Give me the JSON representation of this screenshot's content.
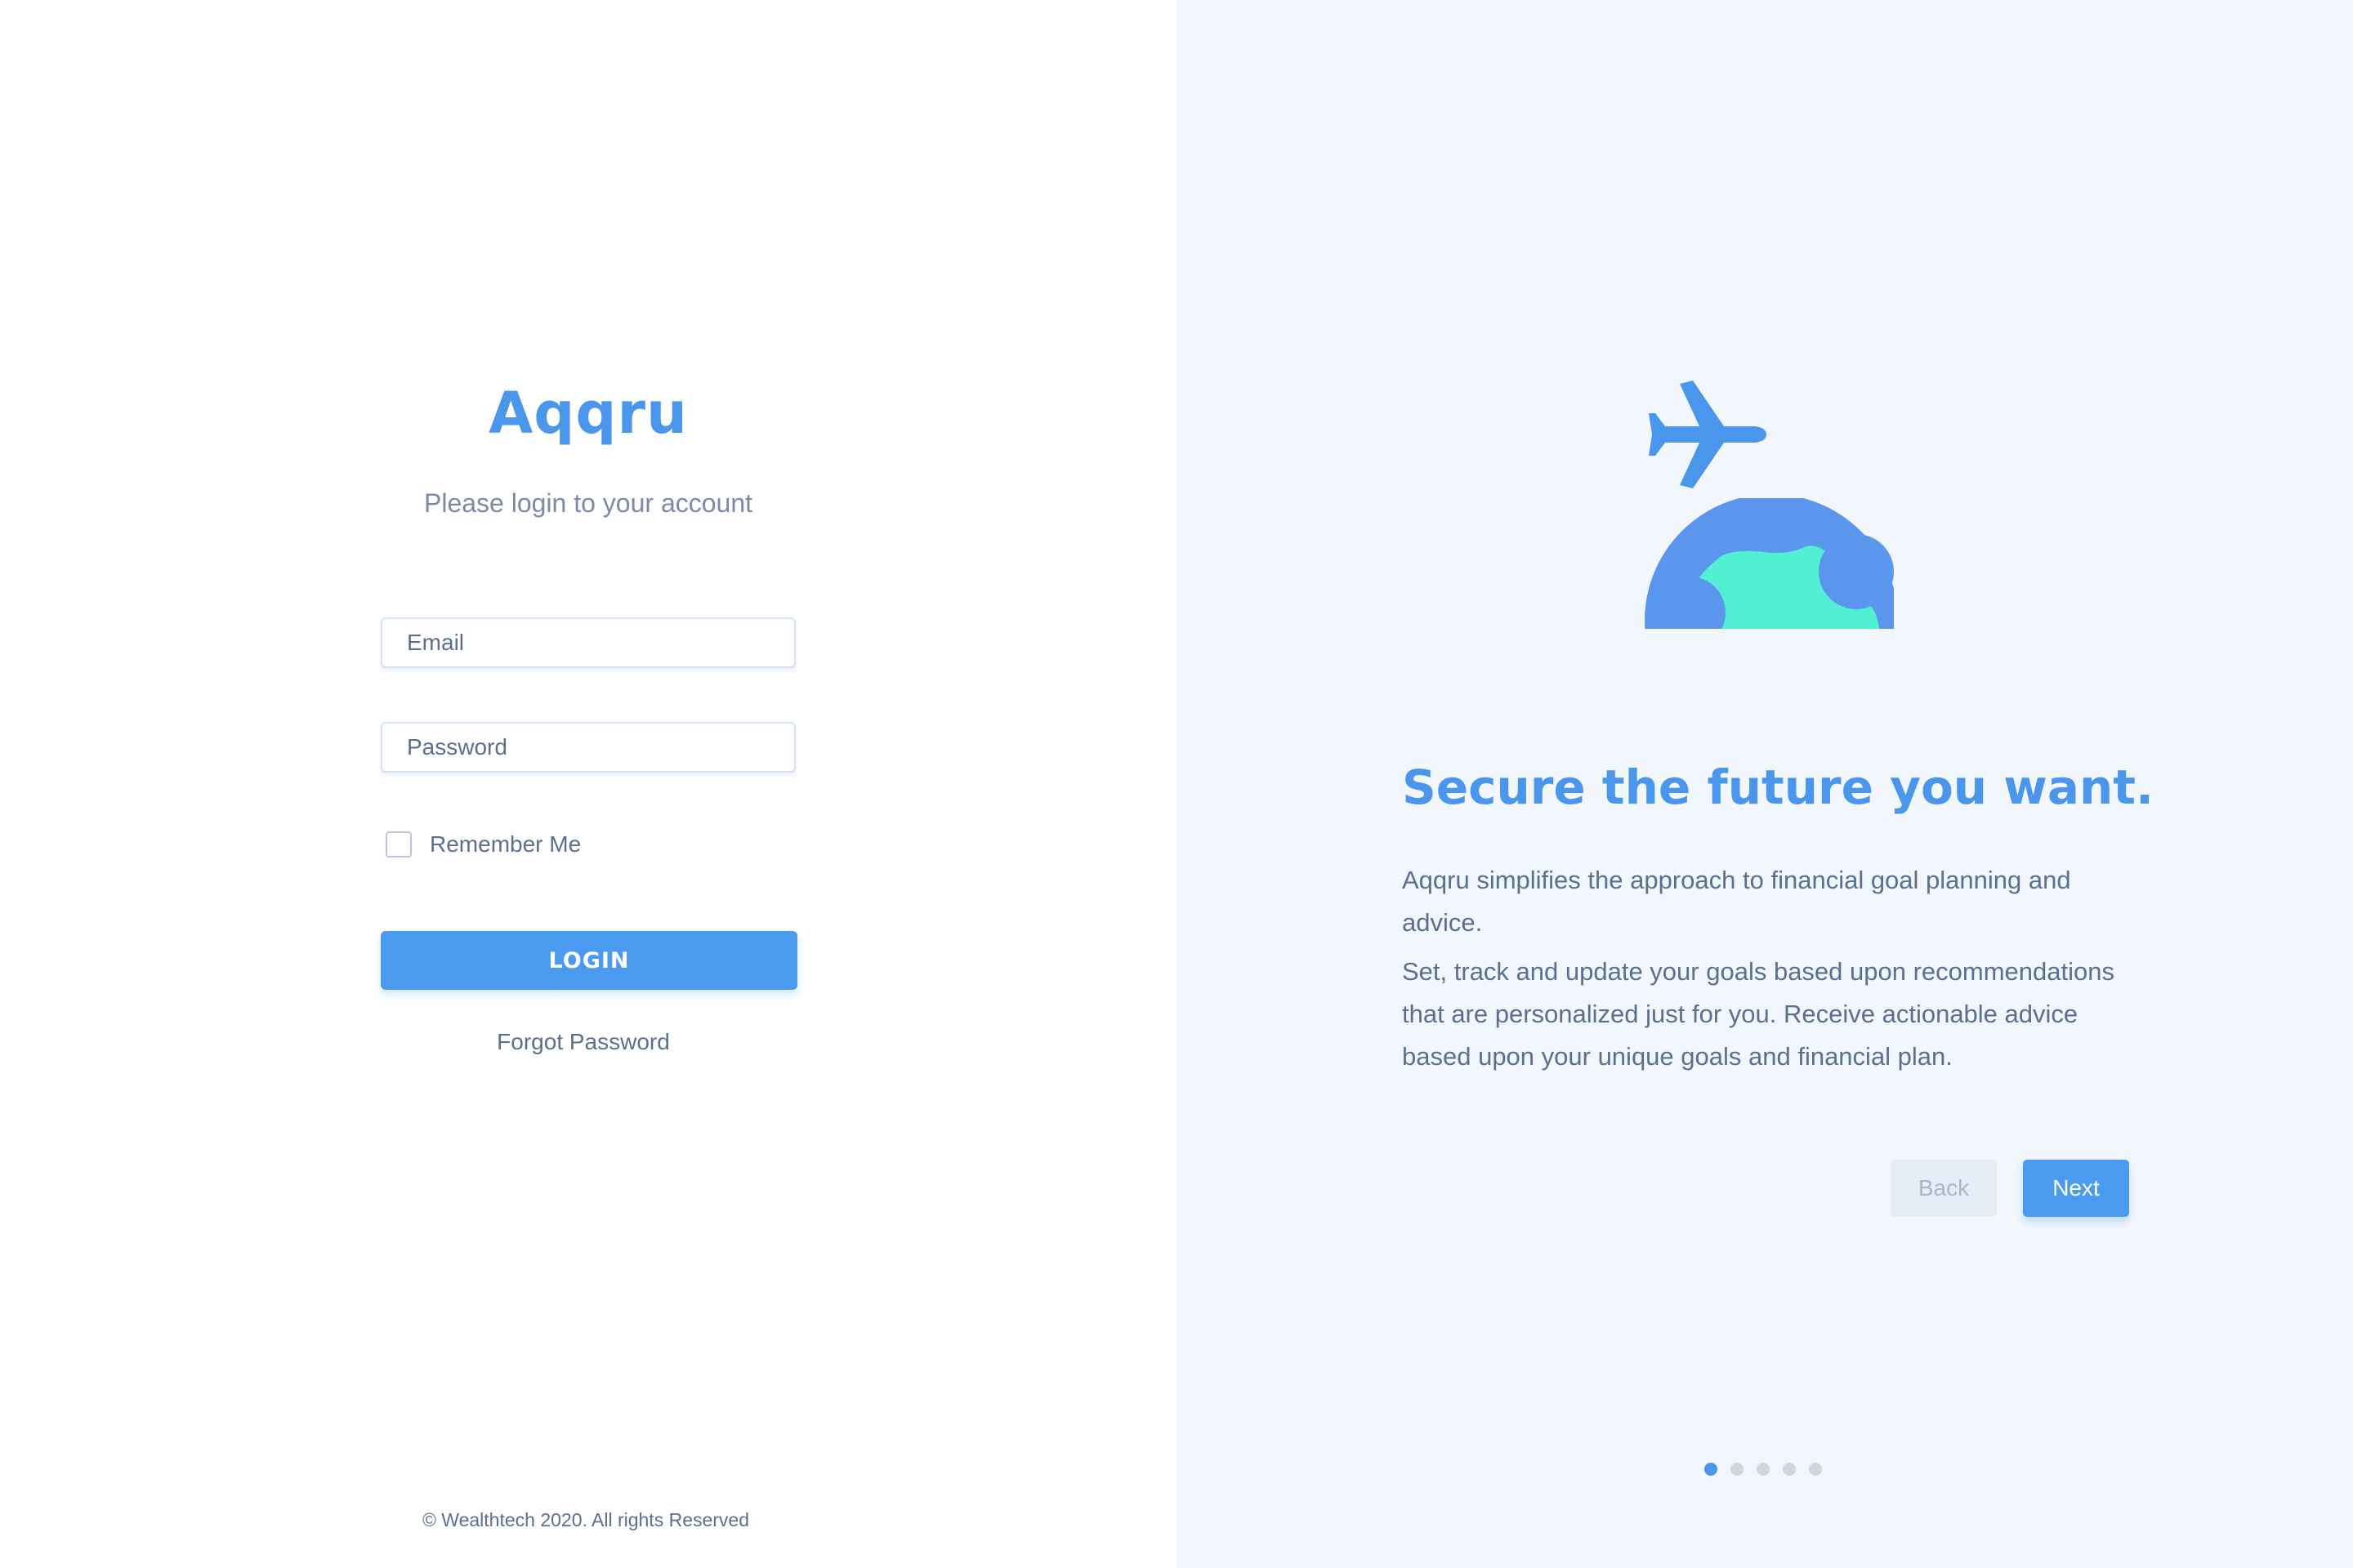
{
  "login": {
    "brand": "Aqqru",
    "subtitle": "Please login to your account",
    "email_placeholder": "Email",
    "password_placeholder": "Password",
    "remember_label": "Remember Me",
    "login_label": "LOGIN",
    "forgot_label": "Forgot Password",
    "footer": "© Wealthtech 2020. All rights Reserved"
  },
  "onboarding": {
    "illustration_icon": "airplane-over-globe-icon",
    "headline": "Secure the future you want.",
    "paragraph1": "Aqqru simplifies the approach to financial goal planning and advice.",
    "paragraph2": "Set, track and update your goals based upon recommendations that are personalized just for you. Receive actionable advice based upon your unique goals and financial plan.",
    "back_label": "Back",
    "next_label": "Next",
    "slide_count": 5,
    "active_slide": 1
  },
  "colors": {
    "accent": "#4a96ec",
    "globe_land": "#52f0d2",
    "right_panel_bg": "#f2f7fd"
  }
}
